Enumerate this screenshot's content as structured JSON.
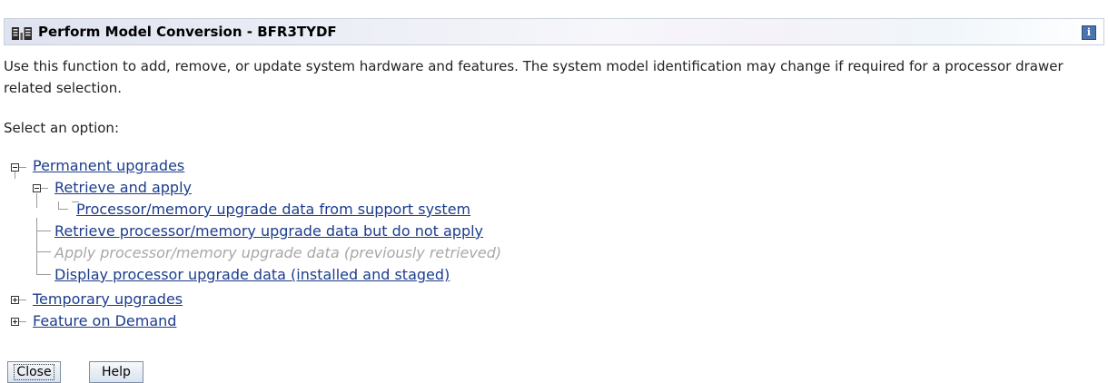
{
  "window": {
    "title": "Perform Model Conversion - BFR3TYDF",
    "info_icon": "i"
  },
  "description": "Use this function to add, remove, or update system hardware and features. The system model identification may change if required for a processor drawer related selection.",
  "prompt": "Select an option:",
  "tree": {
    "permanent": {
      "label": "Permanent upgrades",
      "expanded": true,
      "retrieve_apply": {
        "label": "Retrieve and apply",
        "expanded": true,
        "support_system": "Processor/memory upgrade data from support system"
      },
      "retrieve_no_apply": "Retrieve processor/memory upgrade data but do not apply",
      "apply_previous": "Apply processor/memory upgrade data (previously retrieved)",
      "display_upgrade": "Display processor upgrade data (installed and staged)"
    },
    "temporary": {
      "label": "Temporary upgrades",
      "expanded": false
    },
    "feature_on_demand": {
      "label": "Feature on Demand",
      "expanded": false
    }
  },
  "buttons": {
    "close": "Close",
    "help": "Help"
  },
  "icons": {
    "app": "console-icon",
    "info": "info-icon",
    "expanded": "minus-toggle-icon",
    "collapsed": "plus-toggle-icon"
  },
  "colors": {
    "link": "#1c3d8c",
    "disabled_text": "#a8a8a8",
    "info_button": "#4a74ab"
  }
}
